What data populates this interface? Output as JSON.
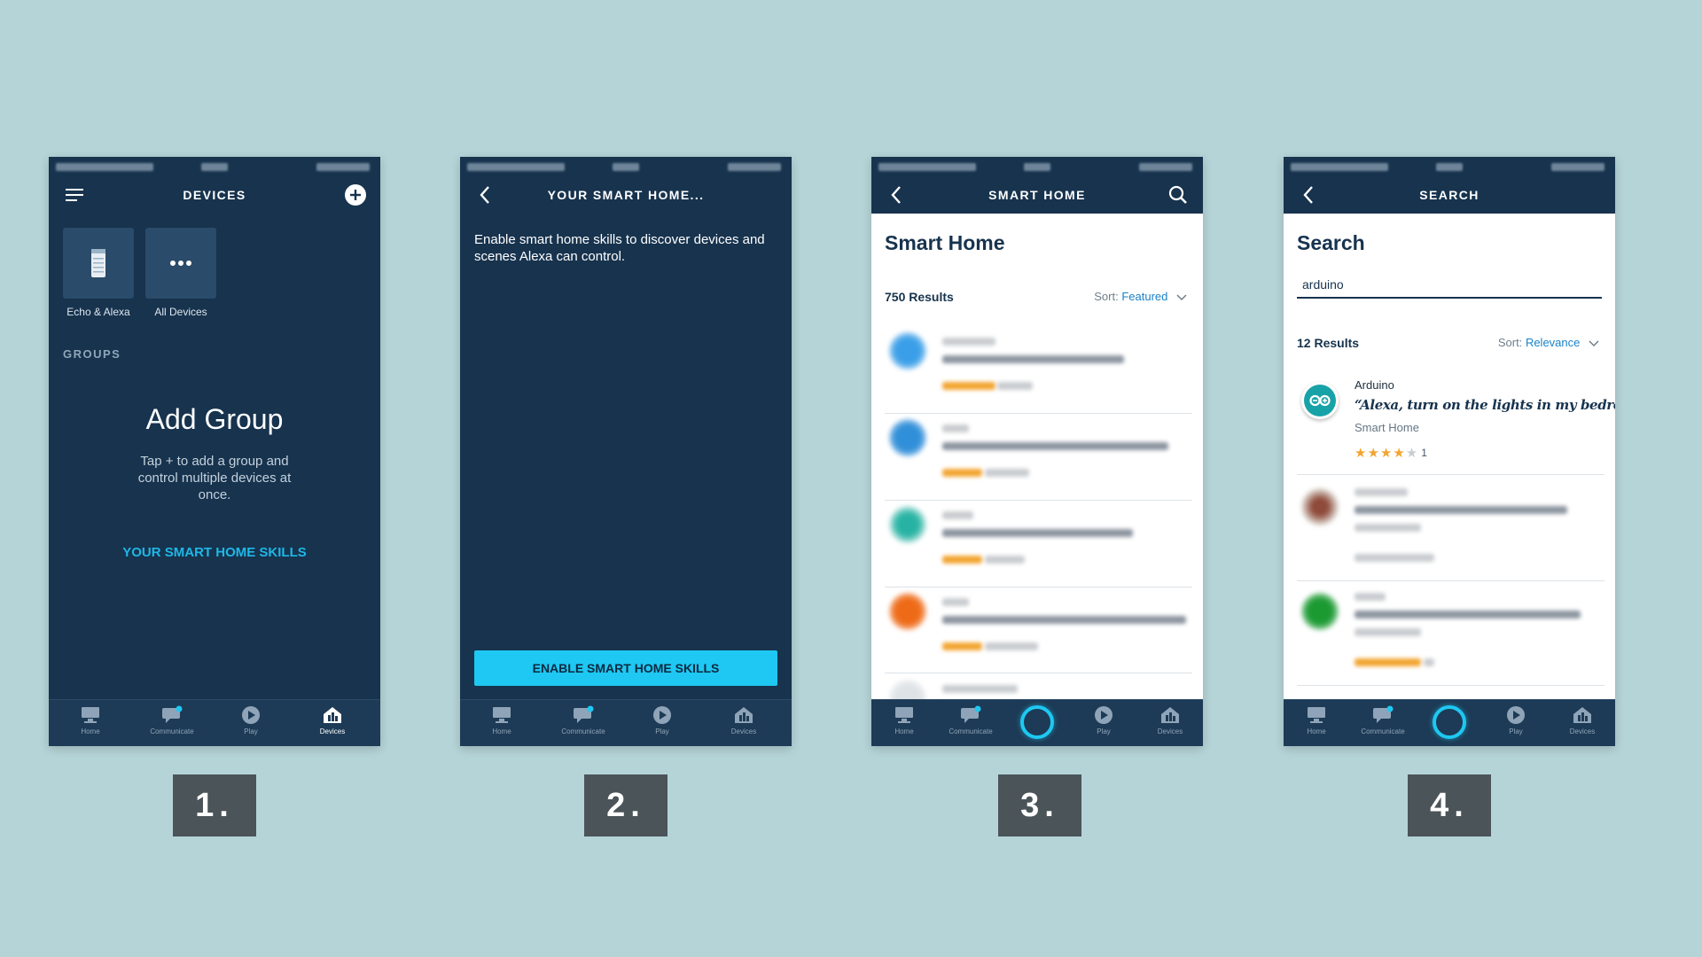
{
  "background_color": "#b5d4d7",
  "nav_labels": {
    "home": "Home",
    "communicate": "Communicate",
    "play": "Play",
    "devices": "Devices"
  },
  "steps": [
    "1.",
    "2.",
    "3.",
    "4."
  ],
  "screen1": {
    "title": "DEVICES",
    "tiles": [
      {
        "label": "Echo & Alexa",
        "icon": "echo-device-icon"
      },
      {
        "label": "All Devices",
        "icon": "more-dots-icon"
      }
    ],
    "groups_heading": "GROUPS",
    "add_group_title": "Add Group",
    "add_group_desc": "Tap + to add a group and control multiple devices at once.",
    "skills_link": "YOUR SMART HOME SKILLS",
    "active_tab": "Devices"
  },
  "screen2": {
    "title": "YOUR SMART HOME...",
    "description": "Enable smart home skills to discover devices and scenes Alexa can control.",
    "enable_button": "ENABLE SMART HOME SKILLS"
  },
  "screen3": {
    "title": "SMART HOME",
    "heading": "Smart Home",
    "results": "750 Results",
    "sort_label": "Sort:",
    "sort_value": "Featured"
  },
  "screen4": {
    "title": "SEARCH",
    "heading": "Search",
    "search_value": "arduino",
    "results": "12 Results",
    "sort_label": "Sort:",
    "sort_value": "Relevance",
    "first_result": {
      "name": "Arduino",
      "phrase": "“Alexa, turn on the lights in my bedroom”",
      "category": "Smart Home",
      "rating": 4,
      "stars_text": "★★★★",
      "stars_empty": "★",
      "rating_count": "1"
    }
  },
  "colors": {
    "header": "#17334e",
    "accent": "#1ec8f2",
    "link": "#1a82c9",
    "star": "#f2a531"
  }
}
